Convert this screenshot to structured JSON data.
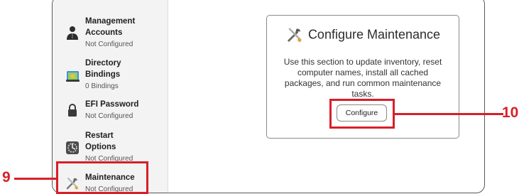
{
  "sidebar": {
    "items": [
      {
        "title": "Management Accounts",
        "subtitle": "Not Configured",
        "icon": "user-icon"
      },
      {
        "title": "Directory Bindings",
        "subtitle": "0 Bindings",
        "icon": "directory-icon"
      },
      {
        "title": "EFI Password",
        "subtitle": "Not Configured",
        "icon": "lock-icon"
      },
      {
        "title": "Restart Options",
        "subtitle": "Not Configured",
        "icon": "restart-icon"
      },
      {
        "title": "Maintenance",
        "subtitle": "Not Configured",
        "icon": "tools-icon"
      }
    ]
  },
  "panel": {
    "title": "Configure Maintenance",
    "description": "Use this section to update inventory, reset computer names, install all cached packages, and run common maintenance tasks.",
    "button_label": "Configure",
    "icon": "tools-icon"
  },
  "callouts": {
    "left": "9",
    "right": "10",
    "color": "#d71f2a"
  }
}
